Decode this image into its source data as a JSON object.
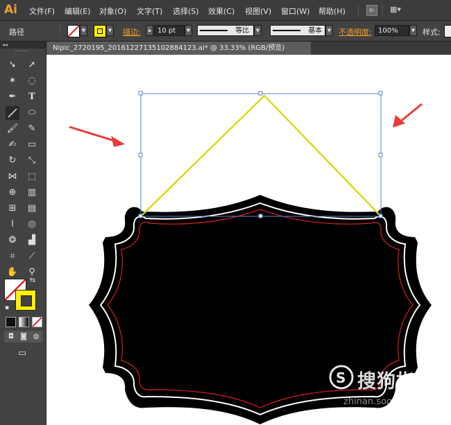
{
  "app": {
    "logo": "Ai"
  },
  "menu": [
    "文件(F)",
    "编辑(E)",
    "对象(O)",
    "文字(T)",
    "选择(S)",
    "效果(C)",
    "视图(V)",
    "窗口(W)",
    "帮助(H)"
  ],
  "bridge_label": "Br",
  "control": {
    "path_label": "路径",
    "stroke_label": "描边:",
    "stroke_value": "10 pt",
    "profile_label": "等比",
    "brush_label": "基本",
    "opacity_label": "不透明度:",
    "opacity_value": "100%",
    "style_label": "样式:"
  },
  "document": {
    "tab_title": "Nipic_2720195_20161227135102884123.ai* @ 33.33% (RGB/预览)"
  },
  "colors": {
    "stroke_line": "#d9d91a",
    "selection": "#5b7fd6",
    "arrow": "#e83a3a",
    "fill_swatch": "#ffef00",
    "accent_orange": "#f59b2a"
  },
  "watermark": {
    "text": "搜狗指南",
    "sub": "zhinan.sogou.com"
  }
}
